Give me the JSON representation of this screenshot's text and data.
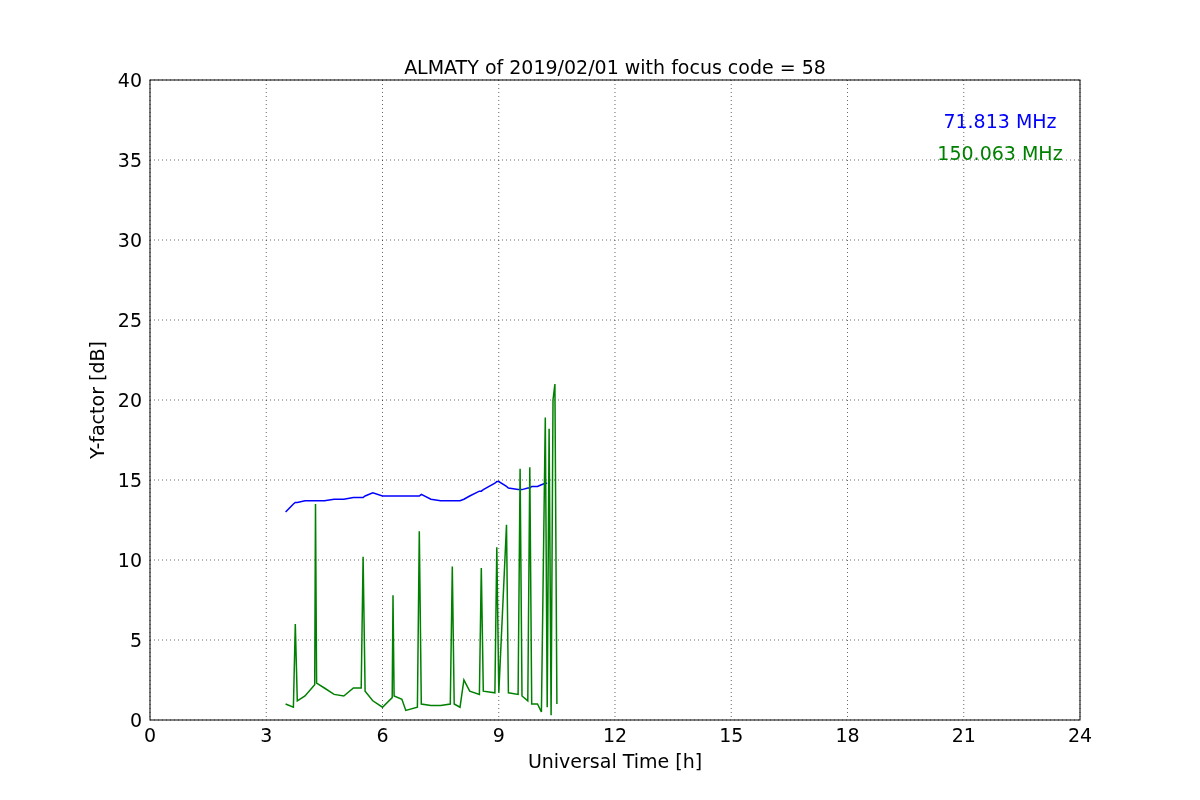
{
  "chart_data": {
    "type": "line",
    "title": "ALMATY of 2019/02/01 with focus code = 58",
    "xlabel": "Universal Time [h]",
    "ylabel": "Y-factor [dB]",
    "x": [
      3.5,
      3.7,
      3.75,
      3.8,
      4,
      4.25,
      4.27,
      4.3,
      4.5,
      4.75,
      5,
      5.25,
      5.45,
      5.5,
      5.55,
      5.75,
      6,
      6.25,
      6.27,
      6.3,
      6.5,
      6.6,
      6.9,
      6.95,
      7,
      7.25,
      7.5,
      7.75,
      7.8,
      7.85,
      8,
      8.1,
      8.25,
      8.5,
      8.55,
      8.6,
      8.9,
      8.95,
      9,
      9.2,
      9.25,
      9.5,
      9.55,
      9.6,
      9.75,
      9.8,
      9.85,
      10,
      10.1,
      10.2,
      10.25,
      10.3,
      10.35,
      10.4,
      10.45,
      10.5
    ],
    "series": [
      {
        "name": "71.813 MHz",
        "color": "#0000ff",
        "values": [
          13,
          13.5,
          13.6,
          13.6,
          13.7,
          13.7,
          13.7,
          13.7,
          13.7,
          13.8,
          13.8,
          13.9,
          13.9,
          13.9,
          14,
          14.2,
          14,
          14,
          14,
          14,
          14,
          14,
          14,
          14,
          14.1,
          13.8,
          13.7,
          13.7,
          13.7,
          13.7,
          13.7,
          13.8,
          14,
          14.3,
          14.3,
          14.4,
          14.8,
          14.9,
          14.9,
          14.6,
          14.5,
          14.4,
          14.4,
          14.4,
          14.5,
          14.5,
          14.6,
          14.6,
          14.7,
          14.8,
          14.8,
          null,
          null,
          null,
          null,
          null
        ]
      },
      {
        "name": "150.063 MHz",
        "color": "#008000",
        "values": [
          1,
          0.8,
          6,
          1.2,
          1.5,
          2.2,
          13.5,
          2.3,
          2,
          1.6,
          1.5,
          2,
          2,
          10.2,
          1.8,
          1.2,
          0.8,
          1.4,
          7.8,
          1.5,
          1.3,
          0.6,
          0.8,
          11.8,
          1,
          0.9,
          0.9,
          1,
          9.6,
          1,
          0.8,
          2.5,
          1.8,
          1.6,
          9.5,
          1.8,
          1.7,
          10.8,
          1.7,
          12.2,
          1.7,
          1.6,
          15.7,
          1.5,
          1.2,
          15.8,
          1,
          1,
          0.5,
          18.9,
          0.8,
          18.2,
          0.3,
          20,
          21,
          1
        ]
      }
    ],
    "xlim": [
      0,
      24
    ],
    "ylim": [
      0,
      40
    ],
    "xticks": [
      0,
      3,
      6,
      9,
      12,
      15,
      18,
      21,
      24
    ],
    "yticks": [
      0,
      5,
      10,
      15,
      20,
      25,
      30,
      35,
      40
    ],
    "grid": true
  }
}
